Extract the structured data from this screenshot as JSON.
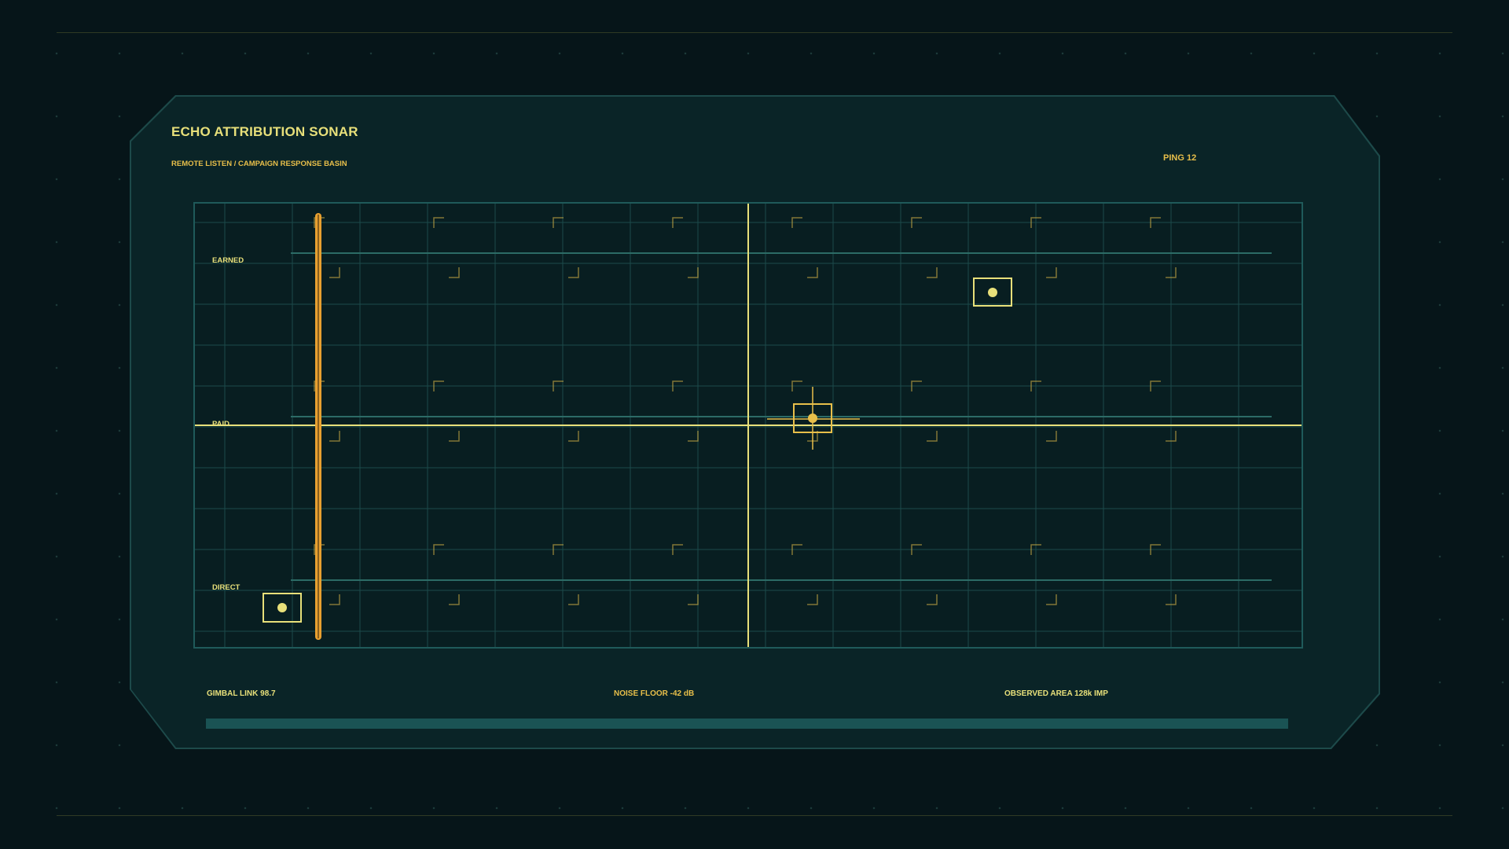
{
  "header": {
    "title": "ECHO ATTRIBUTION SONAR",
    "subtitle": "REMOTE LISTEN / CAMPAIGN RESPONSE BASIN",
    "ping": "PING 12"
  },
  "channels": [
    {
      "label": "EARNED"
    },
    {
      "label": "PAID"
    },
    {
      "label": "DIRECT"
    }
  ],
  "footer": {
    "gimbal": "GIMBAL LINK 98.7",
    "noise": "NOISE FLOOR -42 dB",
    "observed": "OBSERVED AREA 128k IMP"
  },
  "colors": {
    "accent": "#e8e07a",
    "amber": "#e8bf4a",
    "grid": "#1c4a4a",
    "background": "#061519",
    "panel": "#0a2427"
  },
  "echoes": [
    {
      "name": "echo-target-earned",
      "channel": "EARNED",
      "style": "box"
    },
    {
      "name": "echo-target-paid",
      "channel": "PAID",
      "style": "crosshair"
    },
    {
      "name": "echo-target-direct",
      "channel": "DIRECT",
      "style": "box"
    }
  ]
}
